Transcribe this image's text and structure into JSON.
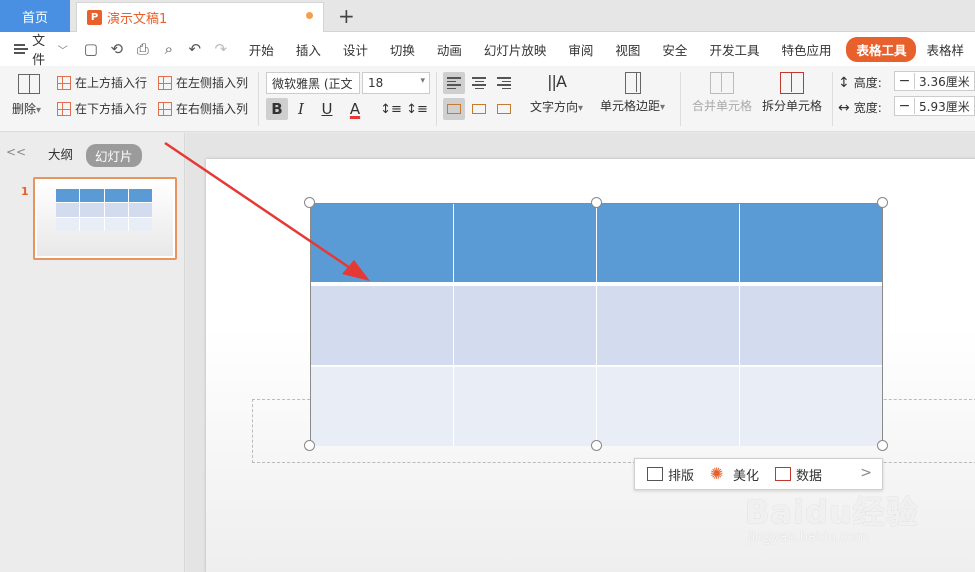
{
  "tabs": {
    "home": "首页",
    "doc_icon": "P",
    "doc_title": "演示文稿1",
    "new_tab": "+"
  },
  "menu": {
    "file": "文件",
    "items": [
      "开始",
      "插入",
      "设计",
      "切换",
      "动画",
      "幻灯片放映",
      "审阅",
      "视图",
      "安全",
      "开发工具",
      "特色应用",
      "表格工具",
      "表格样"
    ],
    "active": "表格工具"
  },
  "ribbon": {
    "delete": "删除",
    "insert_above": "在上方插入行",
    "insert_below": "在下方插入行",
    "insert_left": "在左侧插入列",
    "insert_right": "在右侧插入列",
    "font_name": "微软雅黑 (正文",
    "font_size": "18",
    "bold": "B",
    "italic": "I",
    "underline": "U",
    "font_color": "A",
    "text_direction": "文字方向",
    "cell_margin": "单元格边距",
    "merge_cells": "合并单元格",
    "split_cells": "拆分单元格",
    "height_label": "高度:",
    "height_value": "3.36厘米",
    "width_label": "宽度:",
    "width_value": "5.93厘米",
    "minus": "−"
  },
  "left_panel": {
    "outline_tab": "大纲",
    "slides_tab": "幻灯片",
    "collapse": "<<",
    "slide_number": "1"
  },
  "float_toolbar": {
    "layout": "排版",
    "beautify": "美化",
    "grid_label": "数据",
    "more": ">"
  },
  "watermark": {
    "brand": "Baidu经验",
    "url": "jingyan.baidu.com"
  },
  "colors": {
    "accent": "#e8602c",
    "home_tab": "#4a90e2",
    "header_row": "#5b9bd5",
    "band_row": "#d2dcee",
    "light_row": "#e9edf6",
    "arrow": "#e53935"
  }
}
